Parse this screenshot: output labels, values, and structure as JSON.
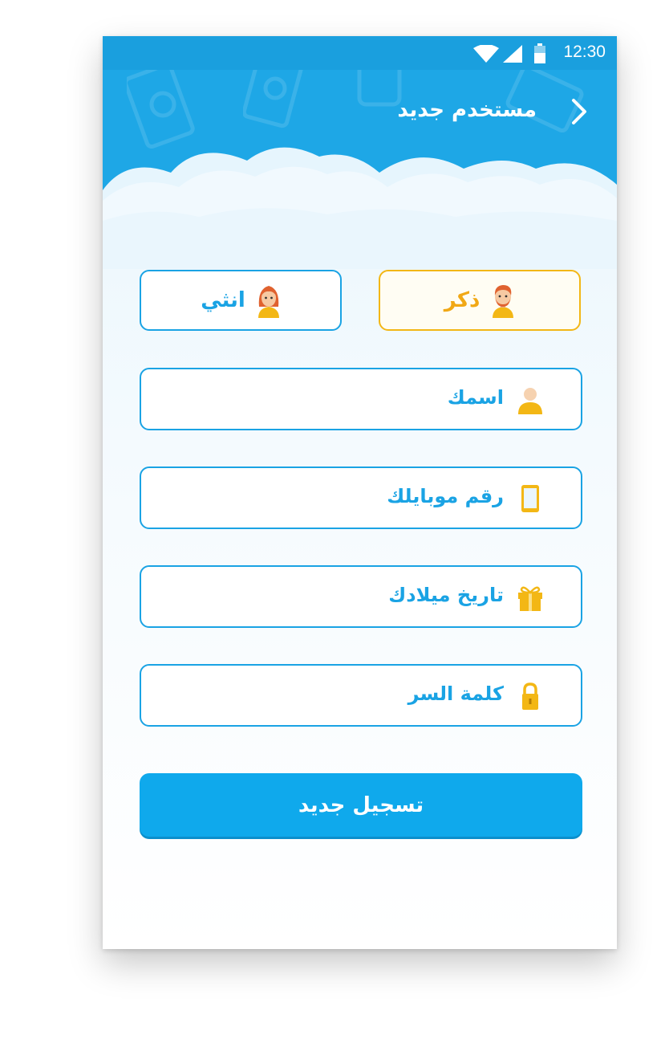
{
  "colors": {
    "primary": "#1aa3e4",
    "accent_selected": "#f3b715",
    "header": "#1ea7e6",
    "button": "#0fa9ec"
  },
  "status_bar": {
    "time": "12:30",
    "icons": [
      "wifi-icon",
      "signal-icon",
      "battery-icon"
    ]
  },
  "topbar": {
    "title": "مستخدم جديد",
    "back_icon": "chevron-right-icon"
  },
  "gender": {
    "options": [
      {
        "label": "ذكر",
        "icon": "male-avatar-icon",
        "selected": true
      },
      {
        "label": "انثي",
        "icon": "female-avatar-icon",
        "selected": false
      }
    ]
  },
  "form": {
    "fields": [
      {
        "label": "اسمك",
        "icon": "user-icon"
      },
      {
        "label": "رقم موبايلك",
        "icon": "mobile-phone-icon"
      },
      {
        "label": "تاريخ ميلادك",
        "icon": "gift-icon"
      },
      {
        "label": "كلمة السر",
        "icon": "lock-icon"
      }
    ],
    "submit_label": "تسجيل جديد"
  }
}
